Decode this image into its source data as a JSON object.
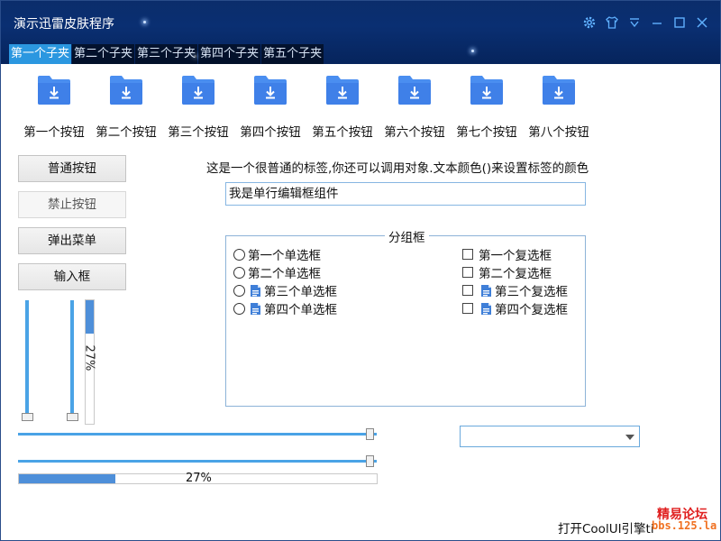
{
  "window": {
    "title": "演示迅雷皮肤程序"
  },
  "titlebar_icons": [
    "gear-icon",
    "shirt-icon",
    "menu-down-icon",
    "minimize-icon",
    "restore-icon",
    "close-icon"
  ],
  "tabs": [
    {
      "label": "第一个子夹",
      "active": true
    },
    {
      "label": "第二个子夹",
      "active": false
    },
    {
      "label": "第三个子夹",
      "active": false
    },
    {
      "label": "第四个子夹",
      "active": false
    },
    {
      "label": "第五个子夹",
      "active": false
    }
  ],
  "toolbar_buttons": [
    {
      "label": "第一个按钮",
      "icon": "download-folder-icon"
    },
    {
      "label": "第二个按钮",
      "icon": "download-folder-icon"
    },
    {
      "label": "第三个按钮",
      "icon": "download-folder-icon"
    },
    {
      "label": "第四个按钮",
      "icon": "download-folder-icon"
    },
    {
      "label": "第五个按钮",
      "icon": "download-folder-icon"
    },
    {
      "label": "第六个按钮",
      "icon": "download-folder-icon"
    },
    {
      "label": "第七个按钮",
      "icon": "download-folder-icon"
    },
    {
      "label": "第八个按钮",
      "icon": "download-folder-icon"
    }
  ],
  "buttons": {
    "normal": "普通按钮",
    "disabled": "禁止按钮",
    "popup_menu": "弹出菜单",
    "input_box": "输入框"
  },
  "plain_label": "这是一个很普通的标签,你还可以调用对象.文本颜色()来设置标签的颜色",
  "single_edit": {
    "value": "我是单行编辑框组件"
  },
  "groupbox": {
    "title": "分组框",
    "radios": [
      {
        "label": "第一个单选框",
        "has_icon": false
      },
      {
        "label": "第二个单选框",
        "has_icon": false
      },
      {
        "label": "第三个单选框",
        "has_icon": true
      },
      {
        "label": "第四个单选框",
        "has_icon": true
      }
    ],
    "checkboxes": [
      {
        "label": "第一个复选框",
        "has_icon": false
      },
      {
        "label": "第二个复选框",
        "has_icon": false
      },
      {
        "label": "第三个复选框",
        "has_icon": true
      },
      {
        "label": "第四个复选框",
        "has_icon": true
      }
    ]
  },
  "vertical_progress": {
    "value": 0.27,
    "text": "27%"
  },
  "horizontal_progress": {
    "value": 0.27,
    "text": "27%"
  },
  "combo": {
    "value": ""
  },
  "status": {
    "text": "打开CoolUI引擎ti"
  },
  "watermark": {
    "line1": "精易论坛",
    "line2": "bbs.125.la"
  },
  "colors": {
    "accent": "#2b97e0",
    "titlebar": "#0a2f72",
    "slider": "#4aa3e6",
    "progress": "#4e8fd9"
  }
}
